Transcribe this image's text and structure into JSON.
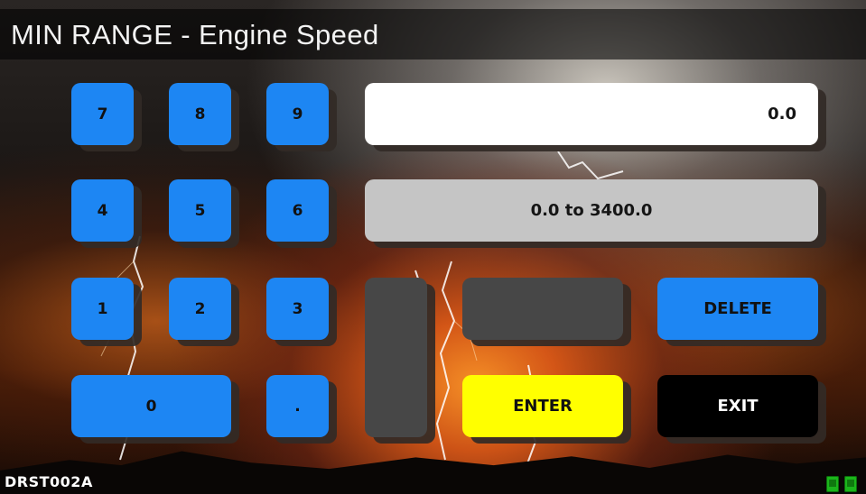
{
  "header": {
    "title": "MIN RANGE - Engine Speed"
  },
  "keypad": {
    "keys": [
      "7",
      "8",
      "9",
      "4",
      "5",
      "6",
      "1",
      "2",
      "3",
      "0",
      "."
    ]
  },
  "entry": {
    "value": "0.0",
    "range": "0.0 to 3400.0"
  },
  "actions": {
    "delete_label": "DELETE",
    "enter_label": "ENTER",
    "exit_label": "EXIT"
  },
  "footer": {
    "screen_id": "DRST002A",
    "status_icons": [
      "memory-chip-icon",
      "memory-chip-icon"
    ]
  },
  "colors": {
    "key_blue": "#1d86f3",
    "enter_yellow": "#ffff00",
    "exit_black": "#000000",
    "field_white": "#ffffff",
    "range_gray": "#c5c5c5",
    "disabled_gray": "#474747",
    "status_green": "#1bb51b"
  }
}
